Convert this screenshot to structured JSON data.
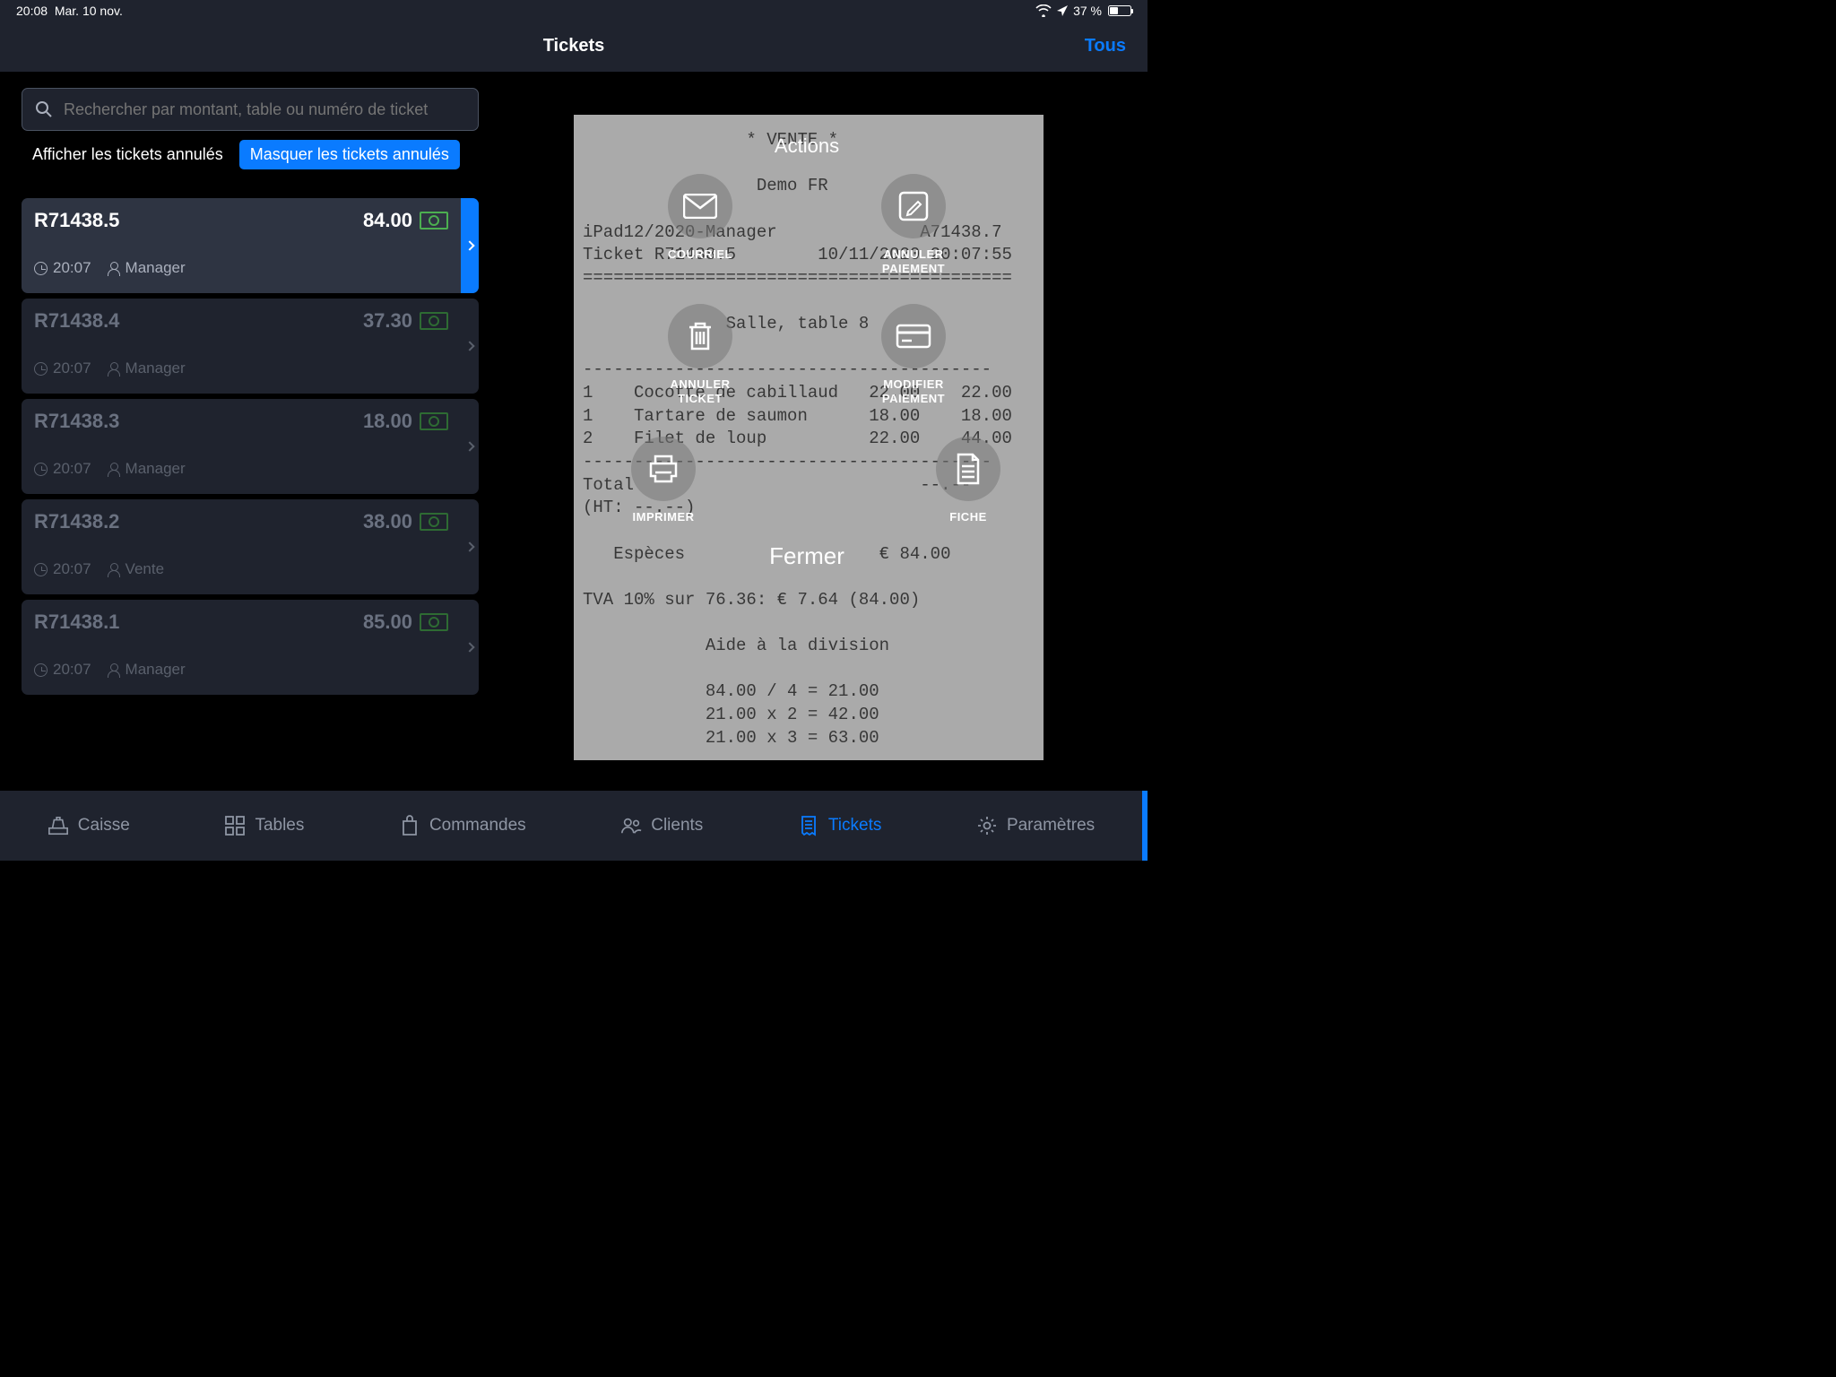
{
  "status": {
    "time": "20:08",
    "date": "Mar. 10 nov.",
    "battery": "37 %"
  },
  "header": {
    "title": "Tickets",
    "right": "Tous"
  },
  "search": {
    "placeholder": "Rechercher par montant, table ou numéro de ticket"
  },
  "toggles": {
    "show": "Afficher les tickets annulés",
    "hide": "Masquer les tickets annulés"
  },
  "tickets": [
    {
      "id": "R71438.5",
      "amount": "84.00",
      "time": "20:07",
      "user": "Manager",
      "selected": true
    },
    {
      "id": "R71438.4",
      "amount": "37.30",
      "time": "20:07",
      "user": "Manager",
      "selected": false
    },
    {
      "id": "R71438.3",
      "amount": "18.00",
      "time": "20:07",
      "user": "Manager",
      "selected": false
    },
    {
      "id": "R71438.2",
      "amount": "38.00",
      "time": "20:07",
      "user": "Vente",
      "selected": false
    },
    {
      "id": "R71438.1",
      "amount": "85.00",
      "time": "20:07",
      "user": "Manager",
      "selected": false
    }
  ],
  "receipt": {
    "header_star": "* VENTE *",
    "company": "Demo FR",
    "device_line": "iPad12/2020-Manager              A71438.7",
    "ticket_line": "Ticket R71438.5        10/11/2020 20:07:55",
    "sep": "==========================================",
    "table_line": "Salle, table 8",
    "items_sep": "----------------------------------------",
    "items": [
      "1    Cocotte de cabillaud   22.00    22.00",
      "1    Tartare de saumon      18.00    18.00",
      "2    Filet de loup          22.00    44.00"
    ],
    "items_sep2": "----------------------------------------",
    "total_line": "Total                            --.--",
    "ht_line": "(HT: --.--)",
    "payment_line": "Espèces                   € 84.00",
    "tva_line": "TVA 10% sur 76.36: € 7.64 (84.00)",
    "division_title": "Aide à la division",
    "divisions": [
      "84.00 / 4 = 21.00",
      "21.00 x 2 = 42.00",
      "21.00 x 3 = 63.00"
    ]
  },
  "actions": {
    "title": "Actions",
    "courriel": "COURRIEL",
    "annuler_paiement": "ANNULER\nPAIEMENT",
    "annuler_ticket": "ANNULER\nTICKET",
    "modifier_paiement": "MODIFIER\nPAIEMENT",
    "imprimer": "IMPRIMER",
    "fiche": "FICHE",
    "close": "Fermer"
  },
  "nav": {
    "caisse": "Caisse",
    "tables": "Tables",
    "commandes": "Commandes",
    "clients": "Clients",
    "tickets": "Tickets",
    "parametres": "Paramètres"
  }
}
